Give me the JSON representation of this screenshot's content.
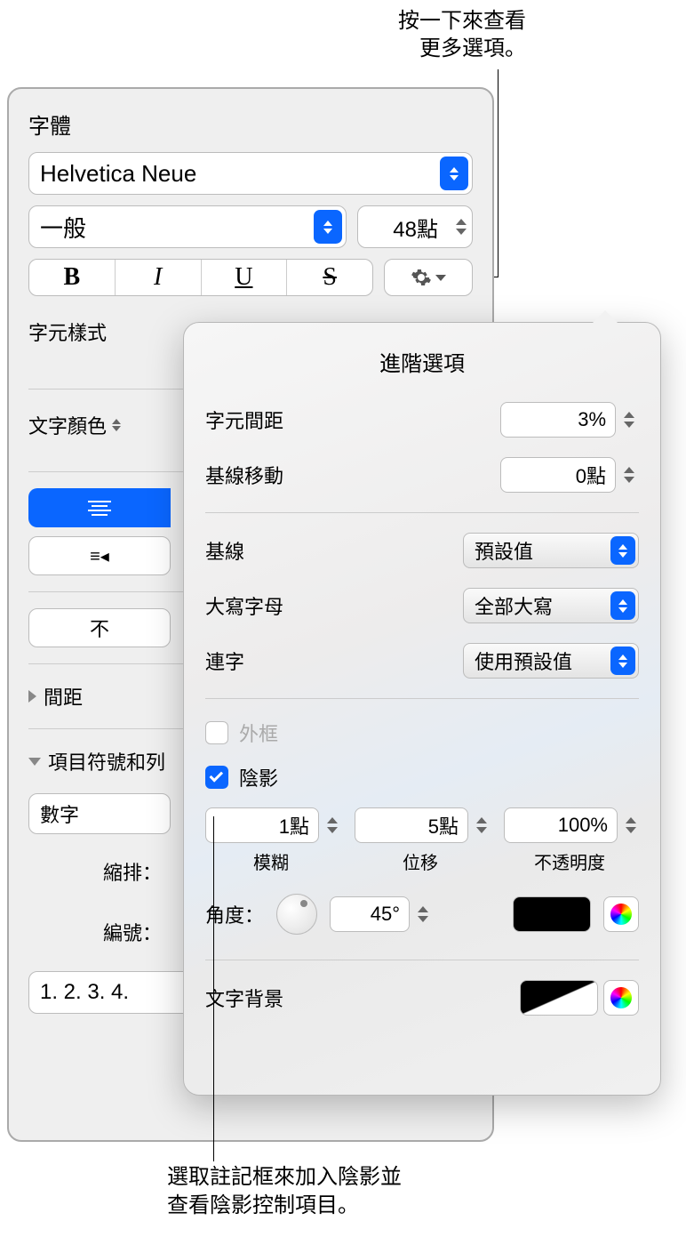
{
  "callouts": {
    "top_l1": "按一下來查看",
    "top_l2": "更多選項。",
    "bottom_l1": "選取註記框來加入陰影並",
    "bottom_l2": "查看陰影控制項目。"
  },
  "font": {
    "section": "字體",
    "family": "Helvetica Neue",
    "style": "一般",
    "size": "48點"
  },
  "char_style_label": "字元樣式",
  "text_color_label": "文字顏色",
  "spacing_label": "間距",
  "bullets_label": "項目符號和列",
  "bullets": {
    "type": "數字",
    "indent_label": "縮排：",
    "number_label": "編號：",
    "format": "1. 2. 3. 4."
  },
  "popover": {
    "title": "進階選項",
    "char_spacing_label": "字元間距",
    "char_spacing_value": "3%",
    "baseline_shift_label": "基線移動",
    "baseline_shift_value": "0點",
    "baseline_label": "基線",
    "baseline_value": "預設值",
    "caps_label": "大寫字母",
    "caps_value": "全部大寫",
    "ligatures_label": "連字",
    "ligatures_value": "使用預設值",
    "outline_label": "外框",
    "shadow_label": "陰影",
    "blur_label": "模糊",
    "blur_value": "1點",
    "offset_label": "位移",
    "offset_value": "5點",
    "opacity_label": "不透明度",
    "opacity_value": "100%",
    "angle_label": "角度：",
    "angle_value": "45°",
    "text_bg_label": "文字背景"
  }
}
